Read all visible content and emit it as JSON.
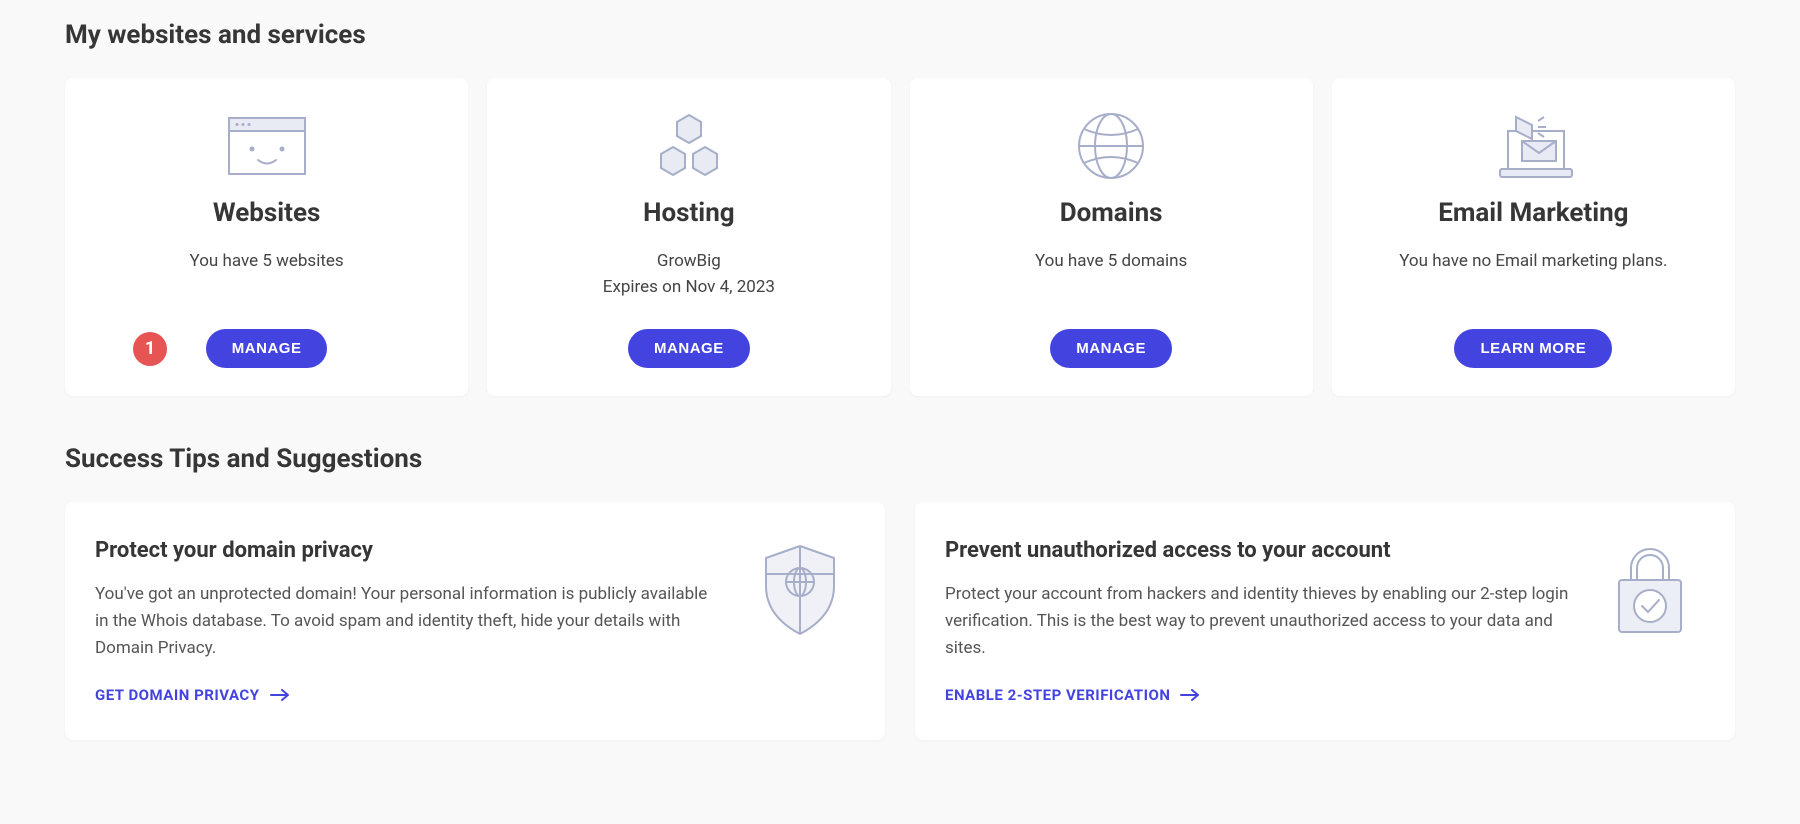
{
  "sections": {
    "services_title": "My websites and services",
    "tips_title": "Success Tips and Suggestions"
  },
  "services": {
    "websites": {
      "title": "Websites",
      "desc": "You have 5 websites",
      "badge": "1",
      "button": "MANAGE"
    },
    "hosting": {
      "title": "Hosting",
      "desc_line1": "GrowBig",
      "desc_line2": "Expires on Nov 4, 2023",
      "button": "MANAGE"
    },
    "domains": {
      "title": "Domains",
      "desc": "You have 5 domains",
      "button": "MANAGE"
    },
    "email_marketing": {
      "title": "Email Marketing",
      "desc": "You have no Email marketing plans.",
      "button": "LEARN MORE"
    }
  },
  "tips": {
    "domain_privacy": {
      "title": "Protect your domain privacy",
      "desc": "You've got an unprotected domain! Your personal information is publicly available in the Whois database. To avoid spam and identity theft, hide your details with Domain Privacy.",
      "link": "GET DOMAIN PRIVACY"
    },
    "two_step": {
      "title": "Prevent unauthorized access to your account",
      "desc": "Protect your account from hackers and identity thieves by enabling our 2-step login verification. This is the best way to prevent unauthorized access to your data and sites.",
      "link": "ENABLE 2-STEP VERIFICATION"
    }
  }
}
